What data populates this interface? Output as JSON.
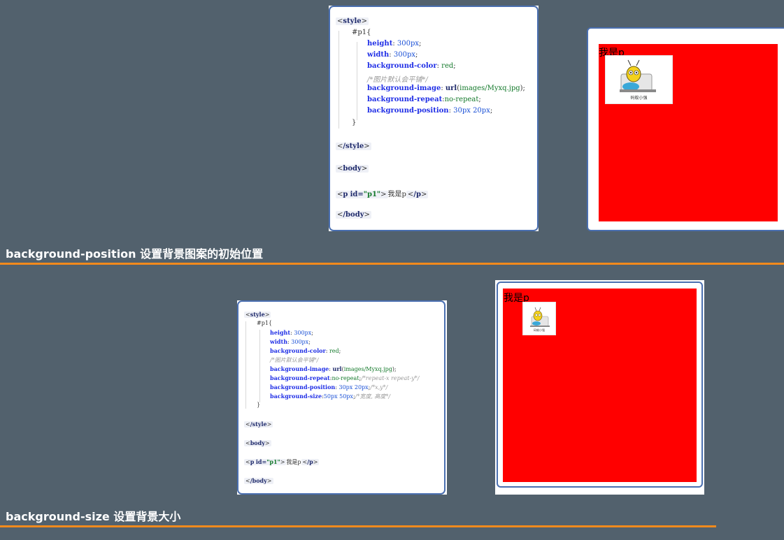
{
  "section1": {
    "caption": "background-position 设置背景图案的初始位置",
    "code": {
      "style_open": "style",
      "selector": "#p1{",
      "height_prop": "height",
      "height_val": "300px",
      "width_prop": "width",
      "width_val": "300px",
      "bgcolor_prop": "background-color",
      "bgcolor_val": "red",
      "comment": "/*图片默认会平铺*/",
      "bgimage_prop": "background-image",
      "bgimage_func": "url",
      "bgimage_val": "images/Myxq.jpg",
      "bgrepeat_prop": "background-repeat",
      "bgrepeat_val": "no-repeat",
      "bgpos_prop": "background-position",
      "bgpos_val": "30px 20px",
      "close_brace": "}",
      "style_close": "/style",
      "body_open": "body",
      "p_tag": "p",
      "p_attr": "id=",
      "p_id": "\"p1\"",
      "p_text": "我是p",
      "p_close": "/p",
      "body_close": "/body"
    },
    "preview": {
      "text": "我是p",
      "logo_label": "码蚁小强"
    }
  },
  "section2": {
    "caption": "background-size 设置背景大小",
    "code": {
      "style_open": "style",
      "selector": "#p1{",
      "height_prop": "height",
      "height_val": "300px",
      "width_prop": "width",
      "width_val": "300px",
      "bgcolor_prop": "background-color",
      "bgcolor_val": "red",
      "comment": "/*图片默认会平铺*/",
      "bgimage_prop": "background-image",
      "bgimage_func": "url",
      "bgimage_val": "images/Myxq.jpg",
      "bgrepeat_prop": "background-repeat",
      "bgrepeat_val": "no-repeat",
      "bgrepeat_cmt": "/*repeat-x  repeat-y*/",
      "bgpos_prop": "background-position",
      "bgpos_val": "30px 20px",
      "bgpos_cmt": "/*x,y*/",
      "bgsize_prop": "background-size",
      "bgsize_val": "50px 50px",
      "bgsize_cmt": "/*宽度, 高度*/",
      "close_brace": "}",
      "style_close": "/style",
      "body_open": "body",
      "p_tag": "p",
      "p_attr": "id=",
      "p_id": "\"p1\"",
      "p_text": "我是p",
      "p_close": "/p",
      "body_close": "/body"
    },
    "preview": {
      "text": "我是p",
      "logo_label": "码蚁小强"
    }
  },
  "colors": {
    "background": "#52616d",
    "accent_rule": "#f28a1c",
    "frame": "#4a6fb0",
    "preview_red": "#ff0000"
  }
}
